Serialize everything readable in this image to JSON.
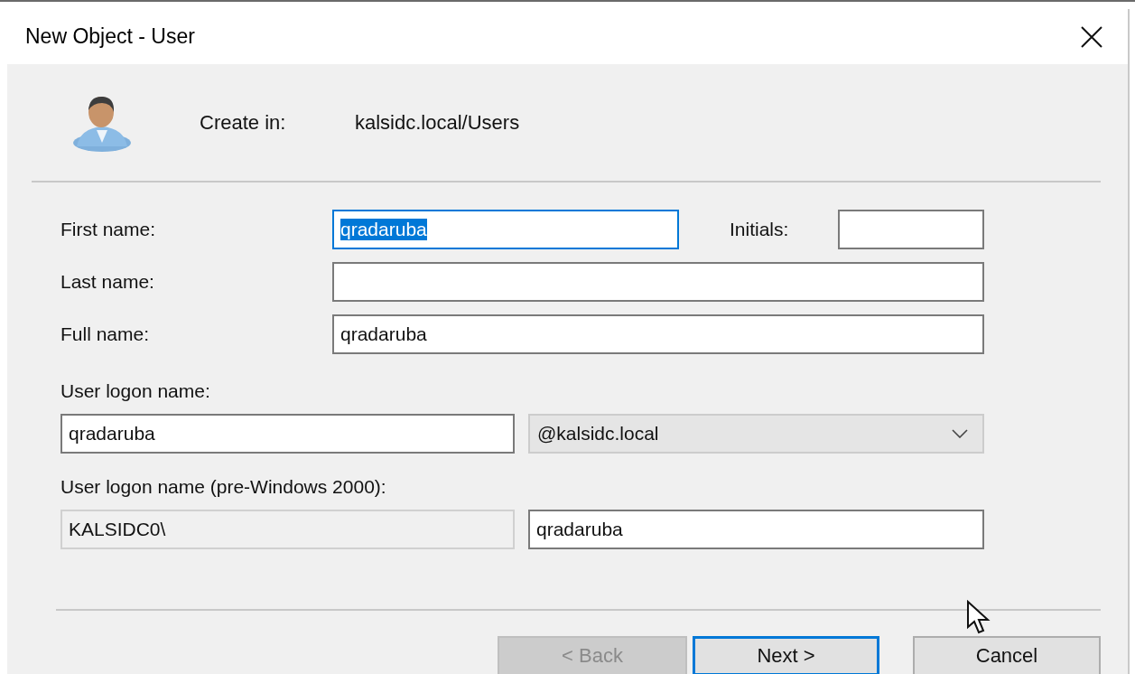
{
  "window": {
    "title": "New Object - User"
  },
  "header": {
    "label": "Create in:",
    "value": "kalsidc.local/Users"
  },
  "first_name": {
    "label": "First name:",
    "value": "qradaruba",
    "focused": true
  },
  "initials": {
    "label": "Initials:"
  },
  "last_name": {
    "label": "Last name:"
  },
  "full_name": {
    "label": "Full name:",
    "value": "qradaruba"
  },
  "logon_name": {
    "label": "User logon name:",
    "value": "qradaruba",
    "domain": "@kalsidc.local"
  },
  "pre_windows": {
    "label": "User logon name (pre-Windows 2000):",
    "domain": "KALSIDC0\\",
    "value": "qradaruba"
  },
  "buttons": [
    {
      "label": "< Back",
      "disabled": true,
      "default": false
    },
    {
      "label": "Next >",
      "disabled": false,
      "default": true
    },
    {
      "label": "Cancel",
      "disabled": false,
      "default": false
    }
  ]
}
